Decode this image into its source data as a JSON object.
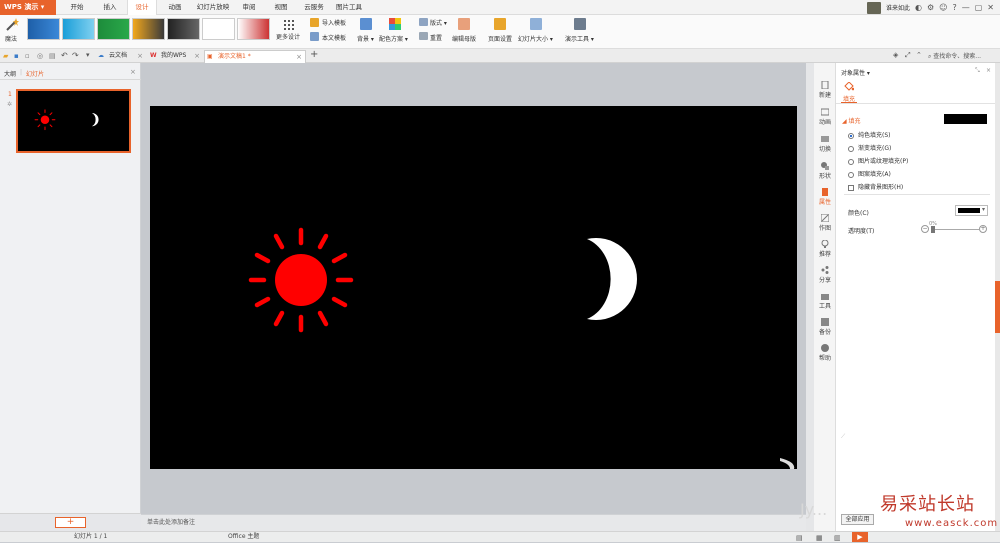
{
  "app": {
    "name": "WPS 演示"
  },
  "menu_tabs": [
    "开始",
    "插入",
    "设计",
    "动画",
    "幻灯片放映",
    "审阅",
    "视图",
    "云服务",
    "图片工具"
  ],
  "user": {
    "name": "谁来如此"
  },
  "ribbon": {
    "magic": "魔法",
    "more_designs": "更多设计",
    "import_template": "导入模板",
    "this_template": "本文模板",
    "background": "背景",
    "color_scheme": "配色方案",
    "layout": "版式",
    "reset": "重置",
    "edit_master": "编辑母版",
    "page_setup": "页面设置",
    "slide_size": "幻灯片大小",
    "presentation_tools": "演示工具"
  },
  "doc_tabs": [
    {
      "label": "云文档"
    },
    {
      "label": "我的WPS"
    },
    {
      "label": "演示文稿1 *"
    }
  ],
  "search": {
    "placeholder": "查找命令、搜索..."
  },
  "left_panel": {
    "tab_outline": "大纲",
    "tab_slides": "幻灯片",
    "slide_number": "1"
  },
  "notes_placeholder": "单击此处添加备注",
  "sidebar": [
    "新建",
    "动画",
    "切换",
    "形状",
    "属性",
    "作图",
    "推荐",
    "分享",
    "工具",
    "备份",
    "帮助"
  ],
  "props": {
    "title": "对象属性",
    "tab_fill": "填充",
    "section_fill": "填充",
    "options": [
      "纯色填充(S)",
      "渐变填充(G)",
      "图片或纹理填充(P)",
      "图案填充(A)"
    ],
    "hide_bg": "隐藏背景图形(H)",
    "color_label": "颜色(C)",
    "transparency_label": "透明度(T)",
    "transparency_value": "0%",
    "apply_all": "全部应用"
  },
  "status": {
    "slide": "幻灯片 1 / 1",
    "theme": "Office 主题"
  },
  "watermark": {
    "cn": "易采站长站",
    "url": "www.easck.com",
    "overlay": "Jy..."
  },
  "colors": {
    "accent": "#e8632b",
    "sun": "#ff0000",
    "moon": "#ffffff",
    "slide_bg": "#000000"
  }
}
